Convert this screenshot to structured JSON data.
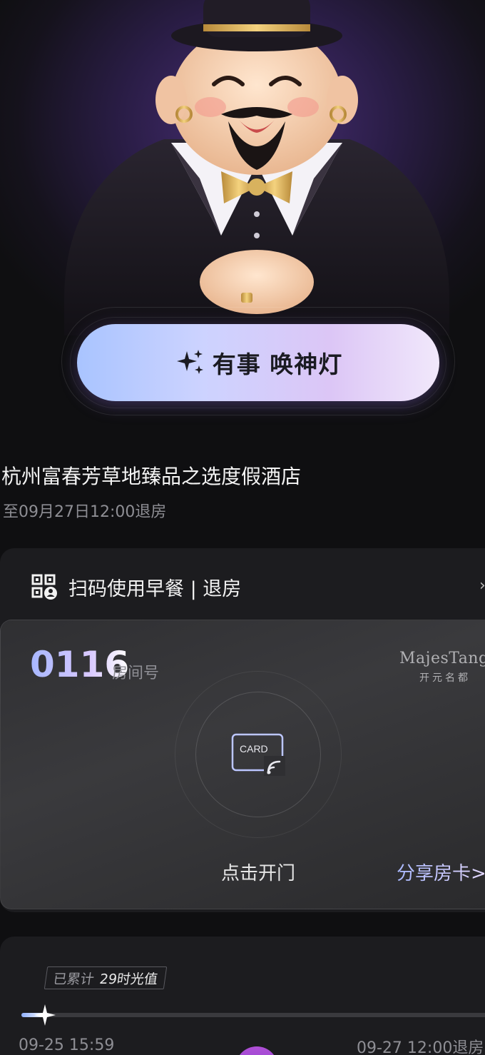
{
  "hero": {
    "cta_label": "有事 唤神灯",
    "cta_icon": "sparkles-icon"
  },
  "hotel": {
    "name": "杭州富春芳草地臻品之选度假酒店",
    "checkout": "至09月27日12:00退房"
  },
  "room": {
    "scan_label": "扫码使用早餐 | 退房",
    "scan_icon": "qr-user-icon",
    "room_number": "0116",
    "room_label": "房间号",
    "brand_en": "MajesTang",
    "brand_zh": "开元名都",
    "card_text": "CARD",
    "open_door_label": "点击开门",
    "share_label": "分享房卡>"
  },
  "stay": {
    "accum_label": "已累计",
    "accum_value": "29时光值",
    "progress": 0.05,
    "start_time": "09-25 15:59",
    "end_time": "09-27 12:00退房"
  },
  "colors": {
    "accent": "#a9c4ff",
    "background": "#0f0f11",
    "panel": "#1c1c1f"
  }
}
